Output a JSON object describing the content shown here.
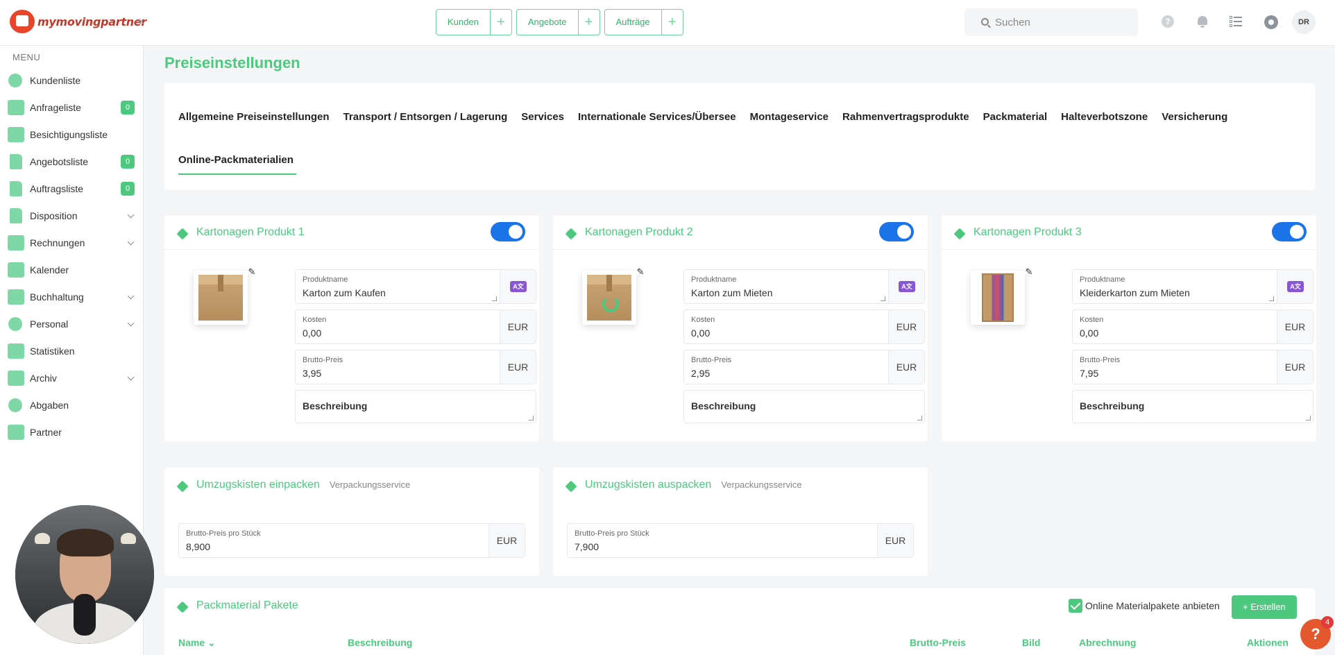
{
  "brand": {
    "name": "mymovingpartner"
  },
  "topnav": {
    "buttons": [
      {
        "label": "Kunden"
      },
      {
        "label": "Angebote"
      },
      {
        "label": "Aufträge"
      }
    ],
    "plus": "+",
    "search_placeholder": "Suchen",
    "help": "?",
    "avatar_initials": "DR"
  },
  "sidebar": {
    "menu_label": "MENU",
    "items": [
      {
        "label": "Kundenliste"
      },
      {
        "label": "Anfrageliste",
        "badge": "0"
      },
      {
        "label": "Besichtigungsliste"
      },
      {
        "label": "Angebotsliste",
        "badge": "0"
      },
      {
        "label": "Auftragsliste",
        "badge": "0"
      },
      {
        "label": "Disposition"
      },
      {
        "label": "Rechnungen"
      },
      {
        "label": "Kalender"
      },
      {
        "label": "Buchhaltung"
      },
      {
        "label": "Personal"
      },
      {
        "label": "Statistiken"
      },
      {
        "label": "Archiv"
      },
      {
        "label": "Abgaben"
      },
      {
        "label": "Partner"
      }
    ]
  },
  "page": {
    "title": "Preiseinstellungen",
    "tabs": [
      "Allgemeine Preiseinstellungen",
      "Transport / Entsorgen / Lagerung",
      "Services",
      "Internationale Services/Übersee",
      "Montageservice",
      "Rahmenvertragsprodukte",
      "Packmaterial",
      "Halteverbotszone",
      "Versicherung"
    ],
    "active_tab": "Online-Packmaterialien"
  },
  "labels": {
    "product_name": "Produktname",
    "costs": "Kosten",
    "gross_price": "Brutto-Preis",
    "description": "Beschreibung",
    "currency": "EUR",
    "gross_per_piece": "Brutto-Preis pro Stück",
    "translate": "A文"
  },
  "products": [
    {
      "title": "Kartonagen Produkt 1",
      "name": "Karton zum Kaufen",
      "cost": "0,00",
      "price": "3,95",
      "enabled": true
    },
    {
      "title": "Kartonagen Produkt 2",
      "name": "Karton zum Mieten",
      "cost": "0,00",
      "price": "2,95",
      "enabled": true
    },
    {
      "title": "Kartonagen Produkt 3",
      "name": "Kleiderkarton zum Mieten",
      "cost": "0,00",
      "price": "7,95",
      "enabled": true
    }
  ],
  "services": [
    {
      "title": "Umzugskisten einpacken",
      "subtitle": "Verpackungsservice",
      "price": "8,900"
    },
    {
      "title": "Umzugskisten auspacken",
      "subtitle": "Verpackungsservice",
      "price": "7,900"
    }
  ],
  "packages": {
    "title": "Packmaterial Pakete",
    "online_checkbox_label": "Online Materialpakete anbieten",
    "online_checked": true,
    "create_label": "+ Erstellen",
    "columns": [
      "Name ⌄",
      "Beschreibung",
      "Brutto-Preis",
      "Bild",
      "Abrechnung",
      "Aktionen"
    ]
  },
  "help_fab": {
    "label": "?",
    "count": "4"
  },
  "colors": {
    "accent": "#4cc97f",
    "toggle": "#1a73e8",
    "translate": "#8a56d8",
    "fab": "#e5572d"
  }
}
